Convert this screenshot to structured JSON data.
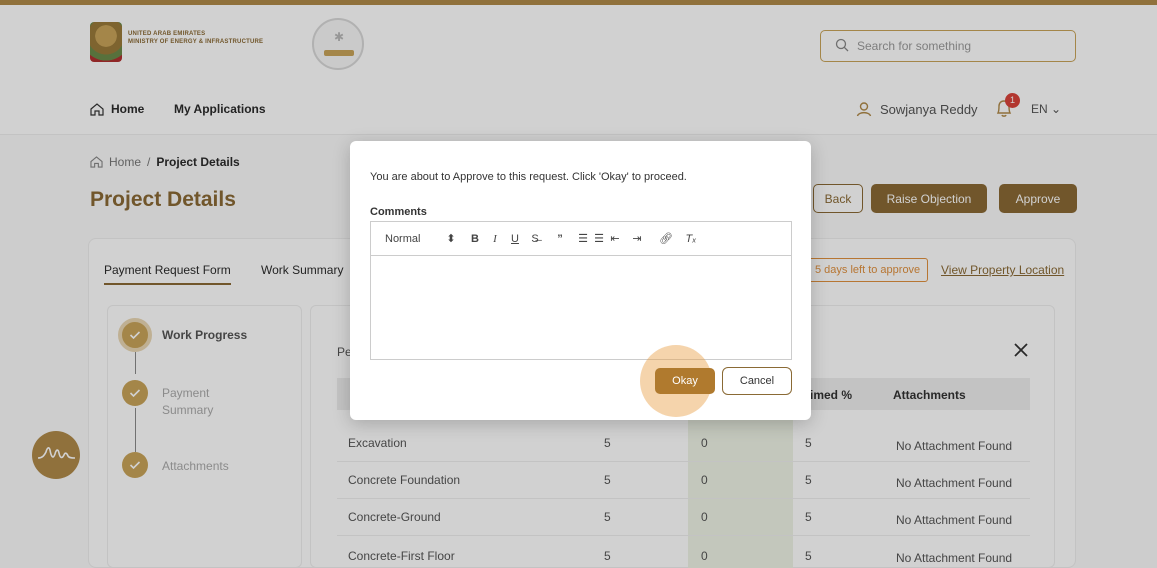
{
  "header": {
    "logo_line1": "UNITED ARAB EMIRATES",
    "logo_line2": "MINISTRY OF ENERGY & INFRASTRUCTURE",
    "search_placeholder": "Search for something",
    "nav": {
      "home": "Home",
      "applications": "My Applications"
    },
    "user_name": "Sowjanya Reddy",
    "notification_count": "1",
    "language": "EN"
  },
  "breadcrumb": {
    "home": "Home",
    "separator": "/",
    "current": "Project Details"
  },
  "page_title": "Project Details",
  "actions": {
    "back": "Back",
    "raise_objection": "Raise Objection",
    "approve": "Approve"
  },
  "tabs": {
    "payment_request": "Payment Request Form",
    "work_summary": "Work Summary"
  },
  "days_left": "5 days left to approve",
  "view_location": "View Property Location",
  "steps": [
    {
      "label": "Work Progress"
    },
    {
      "label": "Payment Summary"
    },
    {
      "label": "Attachments"
    }
  ],
  "table": {
    "title_partial": "Pe",
    "headers": {
      "claimed": "laimed %",
      "attachments": "Attachments"
    },
    "rows": [
      {
        "name": "Excavation",
        "c1": "5",
        "c2": "0",
        "c3": "5",
        "attachment": "No Attachment Found"
      },
      {
        "name": "Concrete Foundation",
        "c1": "5",
        "c2": "0",
        "c3": "5",
        "attachment": "No Attachment Found"
      },
      {
        "name": "Concrete-Ground",
        "c1": "5",
        "c2": "0",
        "c3": "5",
        "attachment": "No Attachment Found"
      },
      {
        "name": "Concrete-First Floor",
        "c1": "5",
        "c2": "0",
        "c3": "5",
        "attachment": "No Attachment Found"
      }
    ]
  },
  "modal": {
    "message": "You are about to Approve to this request. Click 'Okay' to proceed.",
    "comments_label": "Comments",
    "toolbar_format": "Normal",
    "okay": "Okay",
    "cancel": "Cancel"
  },
  "colors": {
    "brand": "#8a6a35",
    "accent": "#c9a45a",
    "warning": "#e0913f",
    "notification": "#d9443b"
  }
}
